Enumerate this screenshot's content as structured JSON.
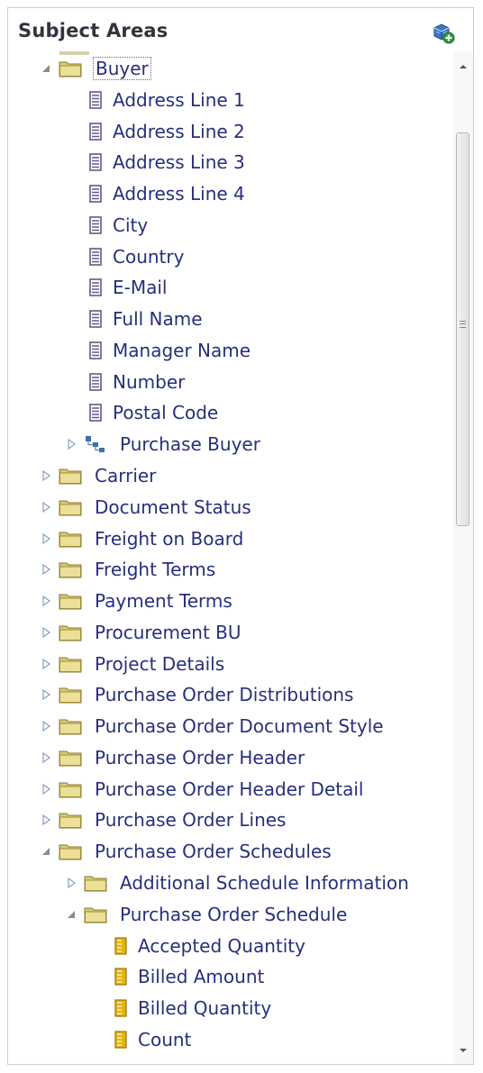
{
  "panel": {
    "title": "Subject Areas",
    "action_icon": "add-subject-area-icon"
  },
  "colors": {
    "label": "#26307c",
    "folder": "#ecdf97",
    "attribute_icon": "#5b5d86",
    "measure_icon": "#e6b415"
  },
  "tree": [
    {
      "label": "Buyer",
      "depth": 0,
      "icon": "folder",
      "toggle": "expanded",
      "focused": true
    },
    {
      "label": "Address Line 1",
      "depth": 1,
      "icon": "attribute",
      "toggle": "none"
    },
    {
      "label": "Address Line 2",
      "depth": 1,
      "icon": "attribute",
      "toggle": "none"
    },
    {
      "label": "Address Line 3",
      "depth": 1,
      "icon": "attribute",
      "toggle": "none"
    },
    {
      "label": "Address Line 4",
      "depth": 1,
      "icon": "attribute",
      "toggle": "none"
    },
    {
      "label": "City",
      "depth": 1,
      "icon": "attribute",
      "toggle": "none"
    },
    {
      "label": "Country",
      "depth": 1,
      "icon": "attribute",
      "toggle": "none"
    },
    {
      "label": "E-Mail",
      "depth": 1,
      "icon": "attribute",
      "toggle": "none"
    },
    {
      "label": "Full Name",
      "depth": 1,
      "icon": "attribute",
      "toggle": "none"
    },
    {
      "label": "Manager Name",
      "depth": 1,
      "icon": "attribute",
      "toggle": "none"
    },
    {
      "label": "Number",
      "depth": 1,
      "icon": "attribute",
      "toggle": "none"
    },
    {
      "label": "Postal Code",
      "depth": 1,
      "icon": "attribute",
      "toggle": "none"
    },
    {
      "label": "Purchase Buyer",
      "depth": 1,
      "icon": "hierarchy",
      "toggle": "collapsed"
    },
    {
      "label": "Carrier",
      "depth": 0,
      "icon": "folder",
      "toggle": "collapsed"
    },
    {
      "label": "Document Status",
      "depth": 0,
      "icon": "folder",
      "toggle": "collapsed"
    },
    {
      "label": "Freight on Board",
      "depth": 0,
      "icon": "folder",
      "toggle": "collapsed"
    },
    {
      "label": "Freight Terms",
      "depth": 0,
      "icon": "folder",
      "toggle": "collapsed"
    },
    {
      "label": "Payment Terms",
      "depth": 0,
      "icon": "folder",
      "toggle": "collapsed"
    },
    {
      "label": "Procurement BU",
      "depth": 0,
      "icon": "folder",
      "toggle": "collapsed"
    },
    {
      "label": "Project Details",
      "depth": 0,
      "icon": "folder",
      "toggle": "collapsed"
    },
    {
      "label": "Purchase Order Distributions",
      "depth": 0,
      "icon": "folder",
      "toggle": "collapsed"
    },
    {
      "label": "Purchase Order Document Style",
      "depth": 0,
      "icon": "folder",
      "toggle": "collapsed"
    },
    {
      "label": "Purchase Order Header",
      "depth": 0,
      "icon": "folder",
      "toggle": "collapsed"
    },
    {
      "label": "Purchase Order Header Detail",
      "depth": 0,
      "icon": "folder",
      "toggle": "collapsed"
    },
    {
      "label": "Purchase Order Lines",
      "depth": 0,
      "icon": "folder",
      "toggle": "collapsed"
    },
    {
      "label": "Purchase Order Schedules",
      "depth": 0,
      "icon": "folder",
      "toggle": "expanded"
    },
    {
      "label": "Additional Schedule Information",
      "depth": 1,
      "icon": "folder",
      "toggle": "collapsed"
    },
    {
      "label": "Purchase Order Schedule",
      "depth": 1,
      "icon": "folder",
      "toggle": "expanded"
    },
    {
      "label": "Accepted Quantity",
      "depth": 2,
      "icon": "measure",
      "toggle": "none"
    },
    {
      "label": "Billed Amount",
      "depth": 2,
      "icon": "measure",
      "toggle": "none"
    },
    {
      "label": "Billed Quantity",
      "depth": 2,
      "icon": "measure",
      "toggle": "none"
    },
    {
      "label": "Count",
      "depth": 2,
      "icon": "measure",
      "toggle": "none"
    }
  ]
}
